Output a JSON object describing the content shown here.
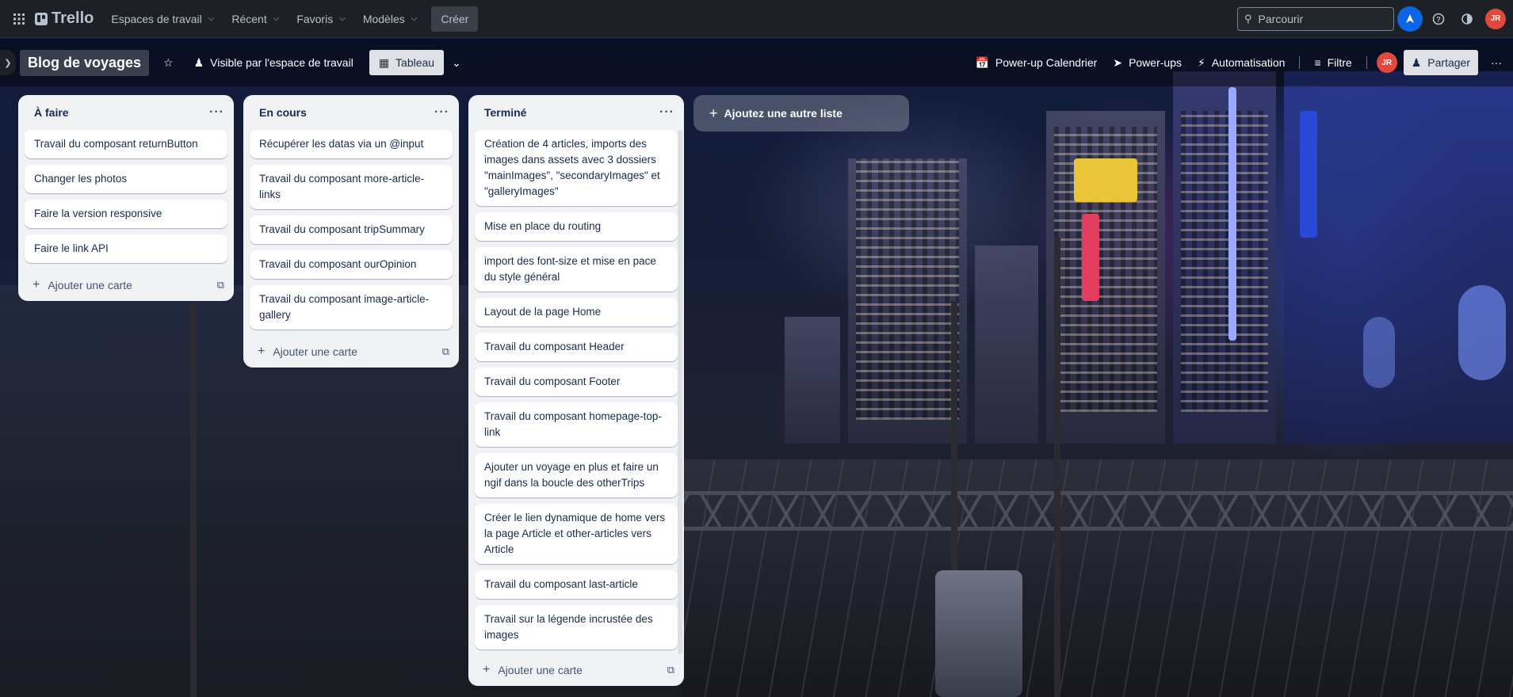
{
  "topnav": {
    "logo": "Trello",
    "menus": [
      "Espaces de travail",
      "Récent",
      "Favoris",
      "Modèles"
    ],
    "create": "Créer",
    "search_placeholder": "Parcourir",
    "avatar": "JR"
  },
  "board": {
    "title": "Blog de voyages",
    "visibility": "Visible par l'espace de travail",
    "view": "Tableau",
    "calendar": "Power-up Calendrier",
    "powerups": "Power-ups",
    "automation": "Automatisation",
    "filter": "Filtre",
    "avatar": "JR",
    "share": "Partager"
  },
  "lists": [
    {
      "title": "À faire",
      "cards": [
        "Travail du composant returnButton",
        "Changer les photos",
        "Faire la version responsive",
        "Faire le link API"
      ],
      "add_card": "Ajouter une carte"
    },
    {
      "title": "En cours",
      "cards": [
        "Récupérer les datas via un @input",
        "Travail du composant more-article-links",
        "Travail du composant tripSummary",
        "Travail du composant ourOpinion",
        "Travail du composant image-article-gallery"
      ],
      "add_card": "Ajouter une carte"
    },
    {
      "title": "Terminé",
      "cards": [
        "Création de 4 articles, imports des images dans assets avec 3 dossiers \"mainImages\", \"secondaryImages\" et \"galleryImages\"",
        "Mise en place du routing",
        "import des font-size et mise en pace du style général",
        "Layout de la page Home",
        "Travail du composant Header",
        "Travail du composant Footer",
        "Travail du composant homepage-top-link",
        "Ajouter un voyage en plus et faire un ngif dans la boucle des otherTrips",
        "Créer le lien dynamique de home vers la page Article et other-articles vers Article",
        "Travail du composant last-article",
        "Travail sur la légende incrustée des images"
      ],
      "add_card": "Ajouter une carte"
    }
  ],
  "add_list": "Ajoutez une autre liste"
}
